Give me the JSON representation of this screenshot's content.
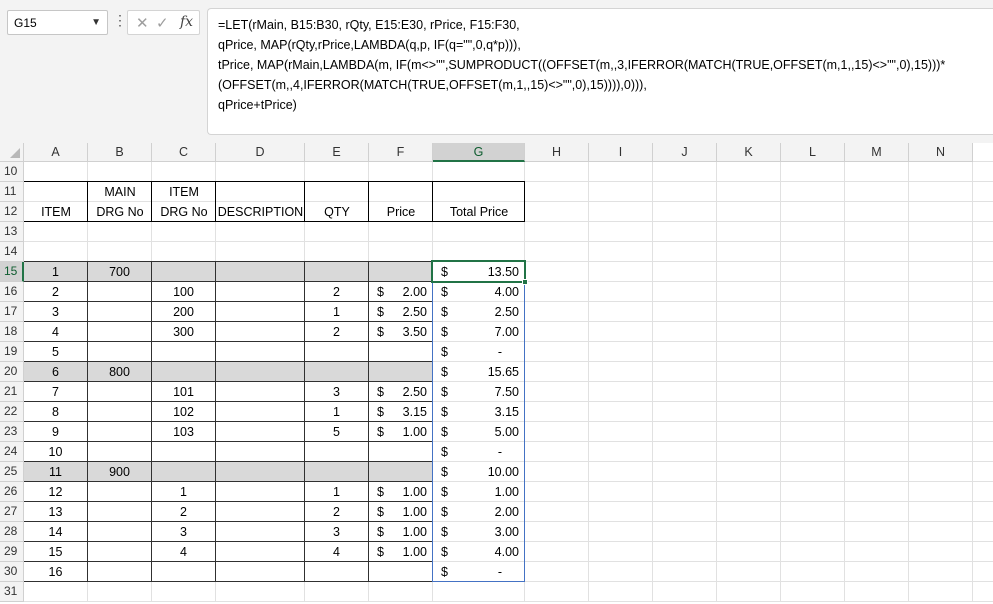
{
  "name_box": {
    "value": "G15"
  },
  "formula_bar": {
    "fx": "fx",
    "lines": [
      "=LET(rMain, B15:B30, rQty, E15:E30, rPrice, F15:F30,",
      "qPrice, MAP(rQty,rPrice,LAMBDA(q,p, IF(q=\"\",0,q*p))),",
      "tPrice, MAP(rMain,LAMBDA(m, IF(m<>\"\",SUMPRODUCT((OFFSET(m,,3,IFERROR(MATCH(TRUE,OFFSET(m,1,,15)<>\"\",0),15)))*",
      "(OFFSET(m,,4,IFERROR(MATCH(TRUE,OFFSET(m,1,,15)<>\"\",0),15)))),0))),",
      "qPrice+tPrice)"
    ]
  },
  "columns": [
    "A",
    "B",
    "C",
    "D",
    "E",
    "F",
    "G",
    "H",
    "I",
    "J",
    "K",
    "L",
    "M",
    "N"
  ],
  "selected_column": "G",
  "selected_row": "15",
  "row_numbers": [
    "10",
    "11",
    "12",
    "13",
    "14",
    "15",
    "16",
    "17",
    "18",
    "19",
    "20",
    "21",
    "22",
    "23",
    "24",
    "25",
    "26",
    "27",
    "28",
    "29",
    "30",
    "31"
  ],
  "headers": {
    "item": "ITEM",
    "main_top": "MAIN",
    "main_bottom": "DRG No",
    "itemdrg_top": "ITEM",
    "itemdrg_bottom": "DRG No",
    "description": "DESCRIPTION",
    "qty": "QTY",
    "price": "Price",
    "total": "Total Price"
  },
  "currency_symbol": "$",
  "rows": [
    {
      "row": "15",
      "item": "1",
      "main": "700",
      "drg": "",
      "qty": "",
      "price": "",
      "total": "13.50",
      "group": true
    },
    {
      "row": "16",
      "item": "2",
      "main": "",
      "drg": "100",
      "qty": "2",
      "price": "2.00",
      "total": "4.00",
      "group": false
    },
    {
      "row": "17",
      "item": "3",
      "main": "",
      "drg": "200",
      "qty": "1",
      "price": "2.50",
      "total": "2.50",
      "group": false
    },
    {
      "row": "18",
      "item": "4",
      "main": "",
      "drg": "300",
      "qty": "2",
      "price": "3.50",
      "total": "7.00",
      "group": false
    },
    {
      "row": "19",
      "item": "5",
      "main": "",
      "drg": "",
      "qty": "",
      "price": "",
      "total": "-",
      "group": false
    },
    {
      "row": "20",
      "item": "6",
      "main": "800",
      "drg": "",
      "qty": "",
      "price": "",
      "total": "15.65",
      "group": true
    },
    {
      "row": "21",
      "item": "7",
      "main": "",
      "drg": "101",
      "qty": "3",
      "price": "2.50",
      "total": "7.50",
      "group": false
    },
    {
      "row": "22",
      "item": "8",
      "main": "",
      "drg": "102",
      "qty": "1",
      "price": "3.15",
      "total": "3.15",
      "group": false
    },
    {
      "row": "23",
      "item": "9",
      "main": "",
      "drg": "103",
      "qty": "5",
      "price": "1.00",
      "total": "5.00",
      "group": false
    },
    {
      "row": "24",
      "item": "10",
      "main": "",
      "drg": "",
      "qty": "",
      "price": "",
      "total": "-",
      "group": false
    },
    {
      "row": "25",
      "item": "11",
      "main": "900",
      "drg": "",
      "qty": "",
      "price": "",
      "total": "10.00",
      "group": true
    },
    {
      "row": "26",
      "item": "12",
      "main": "",
      "drg": "1",
      "qty": "1",
      "price": "1.00",
      "total": "1.00",
      "group": false
    },
    {
      "row": "27",
      "item": "13",
      "main": "",
      "drg": "2",
      "qty": "2",
      "price": "1.00",
      "total": "2.00",
      "group": false
    },
    {
      "row": "28",
      "item": "14",
      "main": "",
      "drg": "3",
      "qty": "3",
      "price": "1.00",
      "total": "3.00",
      "group": false
    },
    {
      "row": "29",
      "item": "15",
      "main": "",
      "drg": "4",
      "qty": "4",
      "price": "1.00",
      "total": "4.00",
      "group": false
    },
    {
      "row": "30",
      "item": "16",
      "main": "",
      "drg": "",
      "qty": "",
      "price": "",
      "total": "-",
      "group": false
    }
  ]
}
